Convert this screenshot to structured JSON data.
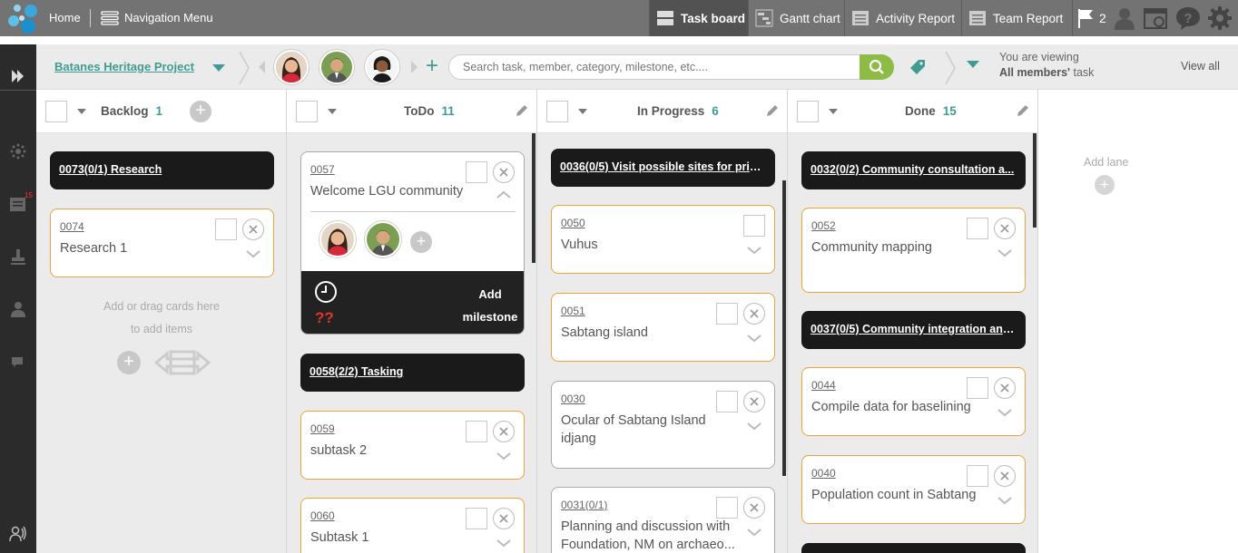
{
  "topbar": {
    "home": "Home",
    "nav_menu": "Navigation Menu",
    "tabs": [
      {
        "label": "Task board",
        "icon": "task-board-icon"
      },
      {
        "label": "Gantt chart",
        "icon": "gantt-chart-icon"
      },
      {
        "label": "Activity Report",
        "icon": "activity-report-icon"
      },
      {
        "label": "Team Report",
        "icon": "team-report-icon"
      }
    ],
    "flag_count": "2"
  },
  "sidebar": {
    "badge": "15",
    "icons": [
      "expand-arrow-icon",
      "dashboard-icon",
      "tasks-icon",
      "stamp-icon",
      "user-icon",
      "chat-icon",
      "contacts-icon"
    ]
  },
  "project": {
    "name": "Batanes Heritage Project",
    "search_placeholder": "Search task, member, category, milestone, etc....",
    "viewing_line1": "You are viewing",
    "viewing_bold": "All members'",
    "viewing_rest": " task",
    "view_all": "View all"
  },
  "lanes": [
    {
      "title": "Backlog",
      "count": "1"
    },
    {
      "title": "ToDo",
      "count": "11"
    },
    {
      "title": "In Progress",
      "count": "6"
    },
    {
      "title": "Done",
      "count": "15"
    }
  ],
  "backlog": {
    "epic": "0073(0/1) Research",
    "card": {
      "id": "0074",
      "title": "Research 1"
    },
    "hint1": "Add or drag cards here",
    "hint2": "to add items"
  },
  "todo": {
    "expanded": {
      "id": "0057",
      "title": "Welcome LGU community",
      "unknown": "??",
      "add_milestone_1": "Add",
      "add_milestone_2": "milestone"
    },
    "epic": "0058(2/2) Tasking",
    "cards": [
      {
        "id": "0059",
        "title": "subtask 2"
      },
      {
        "id": "0060",
        "title": "Subtask 1"
      }
    ]
  },
  "inprogress": {
    "epic": "0036(0/5) Visit possible sites for prior...",
    "cards": [
      {
        "id": "0050",
        "title": "Vuhus"
      },
      {
        "id": "0051",
        "title": "Sabtang island"
      },
      {
        "id": "0030",
        "title": "Ocular of Sabtang Island idjang"
      },
      {
        "id": "0031(0/1)",
        "title": "Planning and discussion with Foundation, NM on archaeo..."
      }
    ]
  },
  "done": {
    "epic1": "0032(0/2) Community consultation a...",
    "card1": {
      "id": "0052",
      "title": "Community mapping"
    },
    "epic2": "0037(0/5) Community integration and...",
    "cards": [
      {
        "id": "0044",
        "title": "Compile data for baselining"
      },
      {
        "id": "0040",
        "title": "Population count in Sabtang"
      }
    ]
  },
  "add_lane": "Add lane"
}
